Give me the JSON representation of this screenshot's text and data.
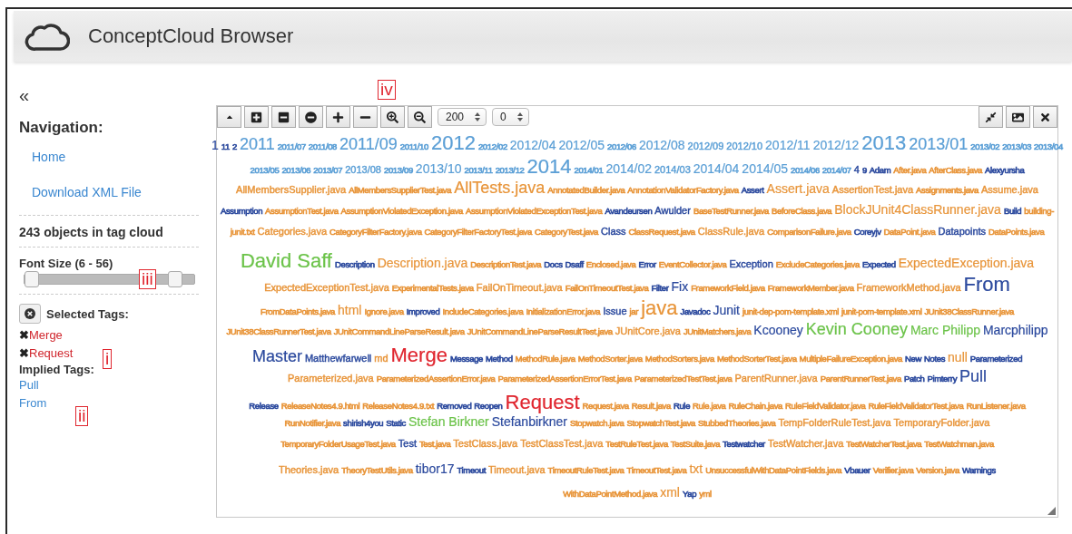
{
  "header": {
    "title": "ConceptCloud Browser"
  },
  "sidebar": {
    "collapse": "«",
    "navigation_title": "Navigation:",
    "links": [
      "Home",
      "Download XML File"
    ],
    "object_count": "243 objects in tag cloud",
    "font_size": {
      "label": "Font Size (6 - 56)",
      "handles": [
        {
          "level": 0.04
        },
        {
          "level": 0.88
        }
      ]
    },
    "selected_title": "Selected Tags:",
    "selected_tags": [
      {
        "mark": "✖",
        "label": "Merge"
      },
      {
        "mark": "✖",
        "label": "Request"
      }
    ],
    "implied_title": "Implied Tags:",
    "implied_tags": [
      "Pull",
      "From"
    ]
  },
  "annotations": [
    "iv",
    "iii",
    "i",
    "ii"
  ],
  "toolbar": {
    "left": [
      {
        "kind": "caret"
      },
      {
        "kind": "square_plus"
      },
      {
        "kind": "square_minus"
      },
      {
        "kind": "circle_minus"
      },
      {
        "kind": "plus"
      },
      {
        "kind": "minus"
      },
      {
        "kind": "zoom_in"
      },
      {
        "kind": "zoom_out"
      }
    ],
    "selects": [
      "200",
      "0"
    ],
    "right": [
      {
        "kind": "compress"
      },
      {
        "kind": "image"
      },
      {
        "kind": "close"
      }
    ]
  },
  "cloud": {
    "lines": [
      [
        {
          "text": "1",
          "color": "#2c4a9e",
          "kind": "medium"
        },
        {
          "text": "11",
          "color": "#2c4a9e",
          "kind": "tiny"
        },
        {
          "text": "2",
          "color": "#2c4a9e",
          "kind": "tiny"
        },
        {
          "text": "2011",
          "color": "#5b9fd6",
          "kind": "large"
        },
        {
          "text": "2011/07",
          "color": "#5b9fd6",
          "kind": "tiny"
        },
        {
          "text": "2011/08",
          "color": "#5b9fd6",
          "kind": "tiny"
        },
        {
          "text": "2011/09",
          "color": "#5b9fd6",
          "kind": "large"
        },
        {
          "text": "2011/10",
          "color": "#5b9fd6",
          "kind": "tiny"
        },
        {
          "text": "2012",
          "color": "#5b9fd6",
          "kind": "huge"
        },
        {
          "text": "2012/02",
          "color": "#5b9fd6",
          "kind": "tiny"
        },
        {
          "text": "2012/04",
          "color": "#5b9fd6",
          "kind": "medium"
        },
        {
          "text": "2012/05",
          "color": "#5b9fd6",
          "kind": "medium"
        },
        {
          "text": "2012/06",
          "color": "#5b9fd6",
          "kind": "tiny"
        },
        {
          "text": "2012/08",
          "color": "#5b9fd6",
          "kind": "medium"
        },
        {
          "text": "2012/09",
          "color": "#5b9fd6",
          "kind": "small"
        },
        {
          "text": "2012/10",
          "color": "#5b9fd6",
          "kind": "small"
        },
        {
          "text": "2012/11",
          "color": "#5b9fd6",
          "kind": "medium"
        },
        {
          "text": "2012/12",
          "color": "#5b9fd6",
          "kind": "medium"
        },
        {
          "text": "2013",
          "color": "#5b9fd6",
          "kind": "huge"
        },
        {
          "text": "2013/01",
          "color": "#5b9fd6",
          "kind": "large"
        },
        {
          "text": "2013/02",
          "color": "#5b9fd6",
          "kind": "tiny"
        },
        {
          "text": "2013/03",
          "color": "#5b9fd6",
          "kind": "tiny"
        },
        {
          "text": "2013/04",
          "color": "#5b9fd6",
          "kind": "tiny"
        }
      ],
      [
        {
          "text": "2013/05",
          "color": "#5b9fd6",
          "kind": "tiny"
        },
        {
          "text": "2013/06",
          "color": "#5b9fd6",
          "kind": "tiny"
        },
        {
          "text": "2013/07",
          "color": "#5b9fd6",
          "kind": "tiny"
        },
        {
          "text": "2013/08",
          "color": "#5b9fd6",
          "kind": "small"
        },
        {
          "text": "2013/09",
          "color": "#5b9fd6",
          "kind": "tiny"
        },
        {
          "text": "2013/10",
          "color": "#5b9fd6",
          "kind": "medium"
        },
        {
          "text": "2013/11",
          "color": "#5b9fd6",
          "kind": "tiny"
        },
        {
          "text": "2013/12",
          "color": "#5b9fd6",
          "kind": "tiny"
        },
        {
          "text": "2014",
          "color": "#5b9fd6",
          "kind": "huge"
        },
        {
          "text": "2014/01",
          "color": "#5b9fd6",
          "kind": "tiny"
        },
        {
          "text": "2014/02",
          "color": "#5b9fd6",
          "kind": "medium"
        },
        {
          "text": "2014/03",
          "color": "#5b9fd6",
          "kind": "small"
        },
        {
          "text": "2014/04",
          "color": "#5b9fd6",
          "kind": "medium"
        },
        {
          "text": "2014/05",
          "color": "#5b9fd6",
          "kind": "medium"
        },
        {
          "text": "2014/06",
          "color": "#5b9fd6",
          "kind": "tiny"
        },
        {
          "text": "2014/07",
          "color": "#5b9fd6",
          "kind": "tiny"
        },
        {
          "text": "4",
          "color": "#2c4a9e",
          "kind": "small"
        },
        {
          "text": "9",
          "color": "#2c4a9e",
          "kind": "tiny"
        },
        {
          "text": "Adam",
          "color": "#2c4a9e",
          "kind": "tiny"
        },
        {
          "text": "After.java",
          "color": "#e8953a",
          "kind": "tiny"
        },
        {
          "text": "AfterClass.java",
          "color": "#e8953a",
          "kind": "tiny"
        },
        {
          "text": "Alexyursha",
          "color": "#2c4a9e",
          "kind": "tiny"
        }
      ],
      [
        {
          "text": "AllMembersSupplier.java",
          "color": "#e8953a",
          "kind": "small"
        },
        {
          "text": "AllMembersSupplierTest.java",
          "color": "#e8953a",
          "kind": "tiny"
        },
        {
          "text": "AllTests.java",
          "color": "#e8953a",
          "kind": "large"
        },
        {
          "text": "AnnotatedBuilder.java",
          "color": "#e8953a",
          "kind": "tiny"
        },
        {
          "text": "AnnotationValidatorFactory.java",
          "color": "#e8953a",
          "kind": "tiny"
        },
        {
          "text": "Assert",
          "color": "#2c4a9e",
          "kind": "tiny"
        },
        {
          "text": "Assert.java",
          "color": "#e8953a",
          "kind": "medium"
        },
        {
          "text": "AssertionTest.java",
          "color": "#e8953a",
          "kind": "small"
        },
        {
          "text": "Assignments.java",
          "color": "#e8953a",
          "kind": "tiny"
        },
        {
          "text": "Assume.java",
          "color": "#e8953a",
          "kind": "small"
        }
      ],
      [
        {
          "text": "Assumption",
          "color": "#2c4a9e",
          "kind": "tiny"
        },
        {
          "text": "AssumptionTest.java",
          "color": "#e8953a",
          "kind": "tiny"
        },
        {
          "text": "AssumptionViolatedException.java",
          "color": "#e8953a",
          "kind": "tiny"
        },
        {
          "text": "AssumptionViolatedExceptionTest.java",
          "color": "#e8953a",
          "kind": "tiny"
        },
        {
          "text": "Avandeursen",
          "color": "#2c4a9e",
          "kind": "tiny"
        },
        {
          "text": "Awulder",
          "color": "#2c4a9e",
          "kind": "small"
        },
        {
          "text": "BaseTestRunner.java",
          "color": "#e8953a",
          "kind": "tiny"
        },
        {
          "text": "BeforeClass.java",
          "color": "#e8953a",
          "kind": "tiny"
        },
        {
          "text": "BlockJUnit4ClassRunner.java",
          "color": "#e8953a",
          "kind": "medium"
        },
        {
          "text": "Build",
          "color": "#2c4a9e",
          "kind": "tiny"
        },
        {
          "text": "building-",
          "color": "#e8953a",
          "kind": "tiny"
        }
      ],
      [
        {
          "text": "junit.txt",
          "color": "#e8953a",
          "kind": "tiny"
        },
        {
          "text": "Categories.java",
          "color": "#e8953a",
          "kind": "small"
        },
        {
          "text": "CategoryFilterFactory.java",
          "color": "#e8953a",
          "kind": "tiny"
        },
        {
          "text": "CategoryFilterFactoryTest.java",
          "color": "#e8953a",
          "kind": "tiny"
        },
        {
          "text": "CategoryTest.java",
          "color": "#e8953a",
          "kind": "tiny"
        },
        {
          "text": "Class",
          "color": "#2c4a9e",
          "kind": "small"
        },
        {
          "text": "ClassRequest.java",
          "color": "#e8953a",
          "kind": "tiny"
        },
        {
          "text": "ClassRule.java",
          "color": "#e8953a",
          "kind": "small"
        },
        {
          "text": "ComparisonFailure.java",
          "color": "#e8953a",
          "kind": "tiny"
        },
        {
          "text": "Coreyjv",
          "color": "#2c4a9e",
          "kind": "tiny"
        },
        {
          "text": "DataPoint.java",
          "color": "#e8953a",
          "kind": "tiny"
        },
        {
          "text": "Datapoints",
          "color": "#2c4a9e",
          "kind": "small"
        },
        {
          "text": "DataPoints.java",
          "color": "#e8953a",
          "kind": "tiny"
        }
      ],
      [
        {
          "text": "David Saff",
          "color": "#6cc34a",
          "kind": "huge"
        },
        {
          "text": "Description",
          "color": "#2c4a9e",
          "kind": "tiny"
        },
        {
          "text": "Description.java",
          "color": "#e8953a",
          "kind": "medium"
        },
        {
          "text": "DescriptionTest.java",
          "color": "#e8953a",
          "kind": "tiny"
        },
        {
          "text": "Docs",
          "color": "#2c4a9e",
          "kind": "tiny"
        },
        {
          "text": "Dsaff",
          "color": "#2c4a9e",
          "kind": "tiny"
        },
        {
          "text": "Enclosed.java",
          "color": "#e8953a",
          "kind": "tiny"
        },
        {
          "text": "Error",
          "color": "#2c4a9e",
          "kind": "tiny"
        },
        {
          "text": "EventCollector.java",
          "color": "#e8953a",
          "kind": "tiny"
        },
        {
          "text": "Exception",
          "color": "#2c4a9e",
          "kind": "small"
        },
        {
          "text": "ExcludeCategories.java",
          "color": "#e8953a",
          "kind": "tiny"
        },
        {
          "text": "Expected",
          "color": "#2c4a9e",
          "kind": "tiny"
        },
        {
          "text": "ExpectedException.java",
          "color": "#e8953a",
          "kind": "medium"
        }
      ],
      [
        {
          "text": "ExpectedExceptionTest.java",
          "color": "#e8953a",
          "kind": "small"
        },
        {
          "text": "ExperimentalTests.java",
          "color": "#e8953a",
          "kind": "tiny"
        },
        {
          "text": "FailOnTimeout.java",
          "color": "#e8953a",
          "kind": "small"
        },
        {
          "text": "FailOnTimeoutTest.java",
          "color": "#e8953a",
          "kind": "tiny"
        },
        {
          "text": "Filter",
          "color": "#2c4a9e",
          "kind": "tiny"
        },
        {
          "text": "Fix",
          "color": "#2c4a9e",
          "kind": "medium"
        },
        {
          "text": "FrameworkField.java",
          "color": "#e8953a",
          "kind": "tiny"
        },
        {
          "text": "FrameworkMember.java",
          "color": "#e8953a",
          "kind": "tiny"
        },
        {
          "text": "FrameworkMethod.java",
          "color": "#e8953a",
          "kind": "small"
        },
        {
          "text": "From",
          "color": "#2c4a9e",
          "kind": "huge"
        }
      ],
      [
        {
          "text": "FromDataPoints.java",
          "color": "#e8953a",
          "kind": "tiny"
        },
        {
          "text": "html",
          "color": "#e8953a",
          "kind": "medium"
        },
        {
          "text": "Ignore.java",
          "color": "#e8953a",
          "kind": "tiny"
        },
        {
          "text": "Improved",
          "color": "#2c4a9e",
          "kind": "tiny"
        },
        {
          "text": "IncludeCategories.java",
          "color": "#e8953a",
          "kind": "tiny"
        },
        {
          "text": "InitializationError.java",
          "color": "#e8953a",
          "kind": "tiny"
        },
        {
          "text": "Issue",
          "color": "#2c4a9e",
          "kind": "small"
        },
        {
          "text": "jar",
          "color": "#e8953a",
          "kind": "tiny"
        },
        {
          "text": "java",
          "color": "#e8953a",
          "kind": "huge"
        },
        {
          "text": "Javadoc",
          "color": "#2c4a9e",
          "kind": "tiny"
        },
        {
          "text": "Junit",
          "color": "#2c4a9e",
          "kind": "medium"
        },
        {
          "text": "junit-dep-pom-template.xml",
          "color": "#e8953a",
          "kind": "tiny"
        },
        {
          "text": "junit-pom-template.xml",
          "color": "#e8953a",
          "kind": "tiny"
        },
        {
          "text": "JUnit38ClassRunner.java",
          "color": "#e8953a",
          "kind": "tiny"
        }
      ],
      [
        {
          "text": "JUnit38ClassRunnerTest.java",
          "color": "#e8953a",
          "kind": "tiny"
        },
        {
          "text": "JUnitCommandLineParseResult.java",
          "color": "#e8953a",
          "kind": "tiny"
        },
        {
          "text": "JUnitCommandLineParseResultTest.java",
          "color": "#e8953a",
          "kind": "tiny"
        },
        {
          "text": "JUnitCore.java",
          "color": "#e8953a",
          "kind": "small"
        },
        {
          "text": "JUnitMatchers.java",
          "color": "#e8953a",
          "kind": "tiny"
        },
        {
          "text": "Kcooney",
          "color": "#2c4a9e",
          "kind": "medium"
        },
        {
          "text": "Kevin Cooney",
          "color": "#6cc34a",
          "kind": "large"
        },
        {
          "text": "Marc Philipp",
          "color": "#6cc34a",
          "kind": "medium"
        },
        {
          "text": "Marcphilipp",
          "color": "#2c4a9e",
          "kind": "medium"
        }
      ],
      [
        {
          "text": "Master",
          "color": "#2c4a9e",
          "kind": "large"
        },
        {
          "text": "Matthewfarwell",
          "color": "#2c4a9e",
          "kind": "small"
        },
        {
          "text": "md",
          "color": "#e8953a",
          "kind": "small"
        },
        {
          "text": "Merge",
          "color": "#e0262f",
          "kind": "huge"
        },
        {
          "text": "Message",
          "color": "#2c4a9e",
          "kind": "tiny"
        },
        {
          "text": "Method",
          "color": "#2c4a9e",
          "kind": "tiny"
        },
        {
          "text": "MethodRule.java",
          "color": "#e8953a",
          "kind": "tiny"
        },
        {
          "text": "MethodSorter.java",
          "color": "#e8953a",
          "kind": "tiny"
        },
        {
          "text": "MethodSorters.java",
          "color": "#e8953a",
          "kind": "tiny"
        },
        {
          "text": "MethodSorterTest.java",
          "color": "#e8953a",
          "kind": "tiny"
        },
        {
          "text": "MultipleFailureException.java",
          "color": "#e8953a",
          "kind": "tiny"
        },
        {
          "text": "New",
          "color": "#2c4a9e",
          "kind": "tiny"
        },
        {
          "text": "Notes",
          "color": "#2c4a9e",
          "kind": "tiny"
        },
        {
          "text": "null",
          "color": "#e8953a",
          "kind": "medium"
        },
        {
          "text": "Parameterized",
          "color": "#2c4a9e",
          "kind": "tiny"
        }
      ],
      [
        {
          "text": "Parameterized.java",
          "color": "#e8953a",
          "kind": "small"
        },
        {
          "text": "ParameterizedAssertionError.java",
          "color": "#e8953a",
          "kind": "tiny"
        },
        {
          "text": "ParameterizedAssertionErrorTest.java",
          "color": "#e8953a",
          "kind": "tiny"
        },
        {
          "text": "ParameterizedTestTest.java",
          "color": "#e8953a",
          "kind": "tiny"
        },
        {
          "text": "ParentRunner.java",
          "color": "#e8953a",
          "kind": "small"
        },
        {
          "text": "ParentRunnerTest.java",
          "color": "#e8953a",
          "kind": "tiny"
        },
        {
          "text": "Patch",
          "color": "#2c4a9e",
          "kind": "tiny"
        },
        {
          "text": "Pimterry",
          "color": "#2c4a9e",
          "kind": "tiny"
        },
        {
          "text": "Pull",
          "color": "#2c4a9e",
          "kind": "large"
        }
      ],
      [
        {
          "text": "Release",
          "color": "#2c4a9e",
          "kind": "tiny"
        },
        {
          "text": "ReleaseNotes4.9.html",
          "color": "#e8953a",
          "kind": "tiny"
        },
        {
          "text": "ReleaseNotes4.9.txt",
          "color": "#e8953a",
          "kind": "tiny"
        },
        {
          "text": "Removed",
          "color": "#2c4a9e",
          "kind": "tiny"
        },
        {
          "text": "Reopen",
          "color": "#2c4a9e",
          "kind": "tiny"
        },
        {
          "text": "Request",
          "color": "#e0262f",
          "kind": "huge"
        },
        {
          "text": "Request.java",
          "color": "#e8953a",
          "kind": "tiny"
        },
        {
          "text": "Result.java",
          "color": "#e8953a",
          "kind": "tiny"
        },
        {
          "text": "Rule",
          "color": "#2c4a9e",
          "kind": "tiny"
        },
        {
          "text": "Rule.java",
          "color": "#e8953a",
          "kind": "tiny"
        },
        {
          "text": "RuleChain.java",
          "color": "#e8953a",
          "kind": "tiny"
        },
        {
          "text": "RuleFieldValidator.java",
          "color": "#e8953a",
          "kind": "tiny"
        },
        {
          "text": "RuleFieldValidatorTest.java",
          "color": "#e8953a",
          "kind": "tiny"
        },
        {
          "text": "RunListener.java",
          "color": "#e8953a",
          "kind": "tiny"
        }
      ],
      [
        {
          "text": "RunNotifier.java",
          "color": "#e8953a",
          "kind": "tiny"
        },
        {
          "text": "shirish4you",
          "color": "#2c4a9e",
          "kind": "tiny"
        },
        {
          "text": "Static",
          "color": "#2c4a9e",
          "kind": "tiny"
        },
        {
          "text": "Stefan Birkner",
          "color": "#6cc34a",
          "kind": "medium"
        },
        {
          "text": "Stefanbirkner",
          "color": "#2c4a9e",
          "kind": "medium"
        },
        {
          "text": "Stopwatch.java",
          "color": "#e8953a",
          "kind": "tiny"
        },
        {
          "text": "StopwatchTest.java",
          "color": "#e8953a",
          "kind": "tiny"
        },
        {
          "text": "StubbedTheories.java",
          "color": "#e8953a",
          "kind": "tiny"
        },
        {
          "text": "TempFolderRuleTest.java",
          "color": "#e8953a",
          "kind": "small"
        },
        {
          "text": "TemporaryFolder.java",
          "color": "#e8953a",
          "kind": "small"
        }
      ],
      [
        {
          "text": "TemporaryFolderUsageTest.java",
          "color": "#e8953a",
          "kind": "tiny"
        },
        {
          "text": "Test",
          "color": "#2c4a9e",
          "kind": "small"
        },
        {
          "text": "Test.java",
          "color": "#e8953a",
          "kind": "tiny"
        },
        {
          "text": "TestClass.java",
          "color": "#e8953a",
          "kind": "small"
        },
        {
          "text": "TestClassTest.java",
          "color": "#e8953a",
          "kind": "small"
        },
        {
          "text": "TestRuleTest.java",
          "color": "#e8953a",
          "kind": "tiny"
        },
        {
          "text": "TestSuite.java",
          "color": "#e8953a",
          "kind": "tiny"
        },
        {
          "text": "Testwatcher",
          "color": "#2c4a9e",
          "kind": "tiny"
        },
        {
          "text": "TestWatcher.java",
          "color": "#e8953a",
          "kind": "small"
        },
        {
          "text": "TestWatcherTest.java",
          "color": "#e8953a",
          "kind": "tiny"
        },
        {
          "text": "TestWatchman.java",
          "color": "#e8953a",
          "kind": "tiny"
        }
      ],
      [
        {
          "text": "Theories.java",
          "color": "#e8953a",
          "kind": "small"
        },
        {
          "text": "TheoryTestUtils.java",
          "color": "#e8953a",
          "kind": "tiny"
        },
        {
          "text": "tibor17",
          "color": "#2c4a9e",
          "kind": "medium"
        },
        {
          "text": "Timeout",
          "color": "#2c4a9e",
          "kind": "tiny"
        },
        {
          "text": "Timeout.java",
          "color": "#e8953a",
          "kind": "small"
        },
        {
          "text": "TimeoutRuleTest.java",
          "color": "#e8953a",
          "kind": "tiny"
        },
        {
          "text": "TimeoutTest.java",
          "color": "#e8953a",
          "kind": "tiny"
        },
        {
          "text": "txt",
          "color": "#e8953a",
          "kind": "medium"
        },
        {
          "text": "UnsuccessfulWithDataPointFields.java",
          "color": "#e8953a",
          "kind": "tiny"
        },
        {
          "text": "Vbauer",
          "color": "#2c4a9e",
          "kind": "tiny"
        },
        {
          "text": "Verifier.java",
          "color": "#e8953a",
          "kind": "tiny"
        },
        {
          "text": "Version.java",
          "color": "#e8953a",
          "kind": "tiny"
        },
        {
          "text": "Warnings",
          "color": "#2c4a9e",
          "kind": "tiny"
        }
      ],
      [
        {
          "text": "WithDataPointMethod.java",
          "color": "#e8953a",
          "kind": "tiny"
        },
        {
          "text": "xml",
          "color": "#e8953a",
          "kind": "medium"
        },
        {
          "text": "Yap",
          "color": "#2c4a9e",
          "kind": "tiny"
        },
        {
          "text": "yml",
          "color": "#e8953a",
          "kind": "tiny"
        }
      ]
    ]
  }
}
